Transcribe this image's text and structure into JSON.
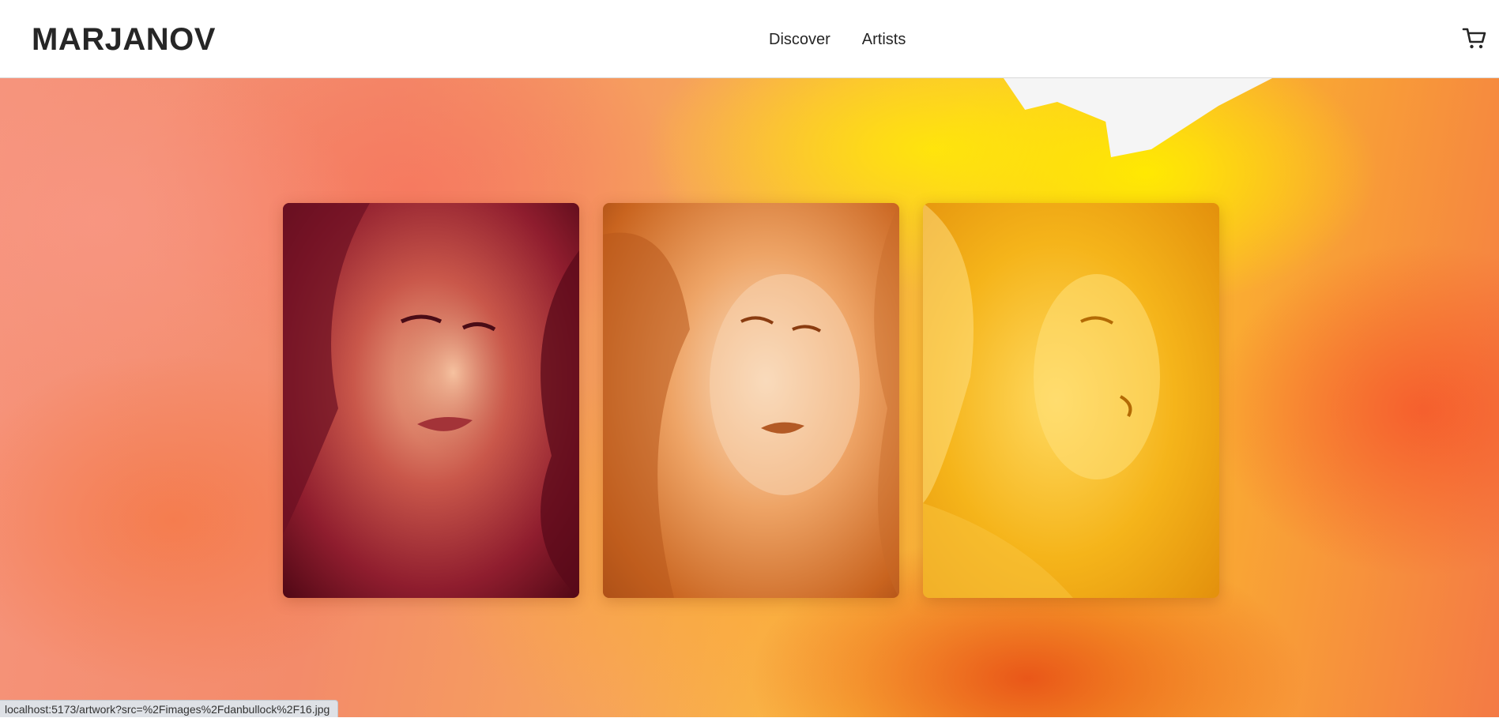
{
  "header": {
    "logo": "MARJANOV",
    "nav": [
      {
        "label": "Discover"
      },
      {
        "label": "Artists"
      }
    ],
    "cart_icon": "shopping-cart-icon"
  },
  "hero": {
    "background": "watercolor-orange-yellow",
    "artworks": [
      {
        "name": "artwork-card-1",
        "palette": "crimson"
      },
      {
        "name": "artwork-card-2",
        "palette": "orange"
      },
      {
        "name": "artwork-card-3",
        "palette": "yellow"
      }
    ]
  },
  "status_bar": {
    "url": "localhost:5173/artwork?src=%2Fimages%2Fdanbullock%2F16.jpg"
  },
  "colors": {
    "text": "#262626",
    "header_bg": "#ffffff",
    "accent_red": "#9e1f2b",
    "accent_orange": "#e8893a",
    "accent_yellow": "#f5c21a"
  }
}
